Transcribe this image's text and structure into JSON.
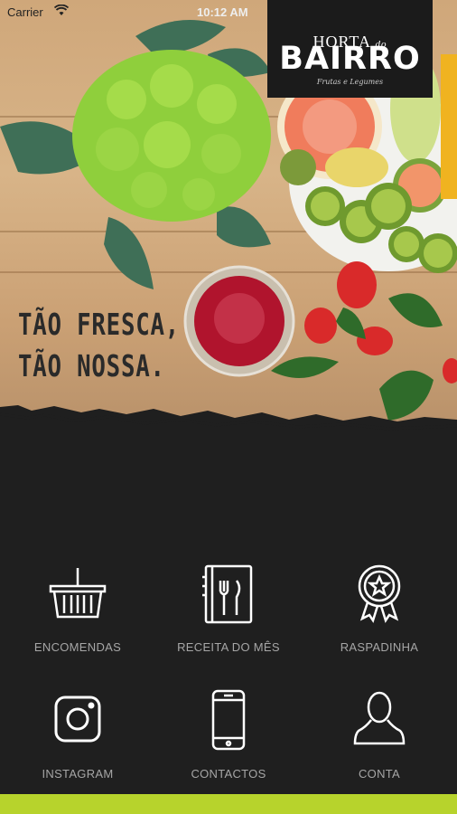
{
  "status_bar": {
    "carrier": "Carrier",
    "time": "10:12 AM",
    "wifi_icon": "wifi-icon"
  },
  "logo": {
    "top": "HORTA",
    "do": "do",
    "main": "BAIRRO",
    "sub": "Frutas e Legumes"
  },
  "hero": {
    "slogan_line1": "TÃO FRESCA,",
    "slogan_line2": "TÃO NOSSA."
  },
  "menu": {
    "items": [
      {
        "label": "ENCOMENDAS",
        "icon": "basket-icon"
      },
      {
        "label": "RECEITA DO MÊS",
        "icon": "recipe-book-icon"
      },
      {
        "label": "RASPADINHA",
        "icon": "award-badge-icon"
      },
      {
        "label": "INSTAGRAM",
        "icon": "instagram-icon"
      },
      {
        "label": "CONTACTOS",
        "icon": "phone-icon"
      },
      {
        "label": "CONTA",
        "icon": "user-icon"
      }
    ]
  },
  "colors": {
    "background": "#1f1f1f",
    "accent_green": "#b7d32c",
    "label_gray": "#a6a6a6"
  }
}
